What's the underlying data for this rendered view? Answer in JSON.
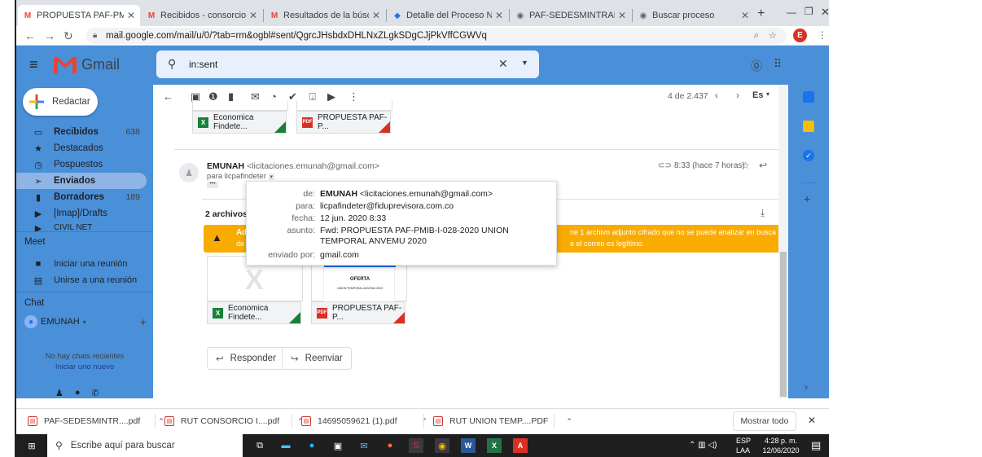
{
  "browser": {
    "tabs": [
      {
        "label": "PROPUESTA PAF-PMIB-",
        "favicon": "M"
      },
      {
        "label": "Recibidos - consorciova",
        "favicon": "M"
      },
      {
        "label": "Resultados de la búsqu",
        "favicon": "M"
      },
      {
        "label": "Detalle del Proceso Nú",
        "favicon": "S"
      },
      {
        "label": "PAF-SEDESMINTRABA",
        "favicon": "G"
      },
      {
        "label": "Buscar proceso",
        "favicon": "G"
      }
    ],
    "new_tab": "+",
    "url": "mail.google.com/mail/u/0/?tab=rm&ogbl#sent/QgrcJHsbdxDHLNxZLgkSDgCJjPkVffCGWVq",
    "profile_initial": "E"
  },
  "header": {
    "app_name": "Gmail",
    "search_value": "in:sent",
    "avatar_initial": "E"
  },
  "sidebar": {
    "compose_label": "Redactar",
    "items": [
      {
        "label": "Recibidos",
        "count": "638",
        "icon": "inbox-icon",
        "bold": true
      },
      {
        "label": "Destacados",
        "count": "",
        "icon": "star-icon",
        "bold": false
      },
      {
        "label": "Pospuestos",
        "count": "",
        "icon": "clock-icon",
        "bold": false
      },
      {
        "label": "Enviados",
        "count": "",
        "icon": "send-icon",
        "bold": true
      },
      {
        "label": "Borradores",
        "count": "189",
        "icon": "draft-icon",
        "bold": true
      },
      {
        "label": "[Imap]/Drafts",
        "count": "",
        "icon": "label-icon",
        "bold": false
      },
      {
        "label": "CIVIL NET",
        "count": "",
        "icon": "label-icon",
        "bold": false
      }
    ],
    "meet_title": "Meet",
    "meet_items": [
      "Iniciar una reunión",
      "Unirse a una reunión"
    ],
    "chat_title": "Chat",
    "chat_user": "EMUNAH",
    "no_chats": "No hay chats recientes",
    "start_new": "Iniciar uno nuevo"
  },
  "toolbar": {
    "pagination": "4 de 2.437",
    "lang": "Es"
  },
  "email": {
    "sender_name": "EMUNAH",
    "sender_email": "<licitaciones.emunah@gmail.com>",
    "to_line": "para licpafindeter",
    "time": "8:33 (hace 7 horas)",
    "attachments_title": "2 archivos adjuntos",
    "warning_title": "Advertencia",
    "warning_text_left": "de conte",
    "warning_text_right_1": "ne 1 archivo adjunto cifrado que no se puede analizar en busca",
    "warning_text_right_2": "e el correo es legítimo.",
    "attachments": [
      {
        "name": "Economica Findete...",
        "type": "X",
        "color": "#188038"
      },
      {
        "name": "PROPUESTA PAF-P...",
        "type": "PDF",
        "color": "#d93025"
      }
    ],
    "pdf_preview_title": "OFERTA",
    "pdf_preview_sub": "UNION TEMPORAL ANVEMU 2020",
    "reply_label": "Responder",
    "forward_label": "Reenviar"
  },
  "popup": {
    "rows": [
      {
        "label": "de:",
        "name": "EMUNAH",
        "value": "<licitaciones.emunah@gmail.com>"
      },
      {
        "label": "para:",
        "name": "",
        "value": "licpafindeter@fiduprevisora.com.co"
      },
      {
        "label": "fecha:",
        "name": "",
        "value": "12 jun. 2020 8:33"
      },
      {
        "label": "asunto:",
        "name": "",
        "value": "Fwd: PROPUESTA PAF-PMIB-I-028-2020 UNION TEMPORAL ANVEMU 2020"
      },
      {
        "label": "enviado por:",
        "name": "",
        "value": "gmail.com"
      }
    ]
  },
  "downloads": {
    "items": [
      "PAF-SEDESMINTR....pdf",
      "RUT CONSORCIO I....pdf",
      "14695059621 (1).pdf",
      "RUT UNION TEMP....PDF"
    ],
    "show_all": "Mostrar todo"
  },
  "taskbar": {
    "search_placeholder": "Escribe aquí para buscar",
    "lang_top": "ESP",
    "lang_bottom": "LAA",
    "time": "4:28 p. m.",
    "date": "12/06/2020"
  },
  "colors": {
    "gmail_blue": "#4a90d9",
    "warning": "#f9ab00",
    "gmail_red": "#ea4335"
  }
}
